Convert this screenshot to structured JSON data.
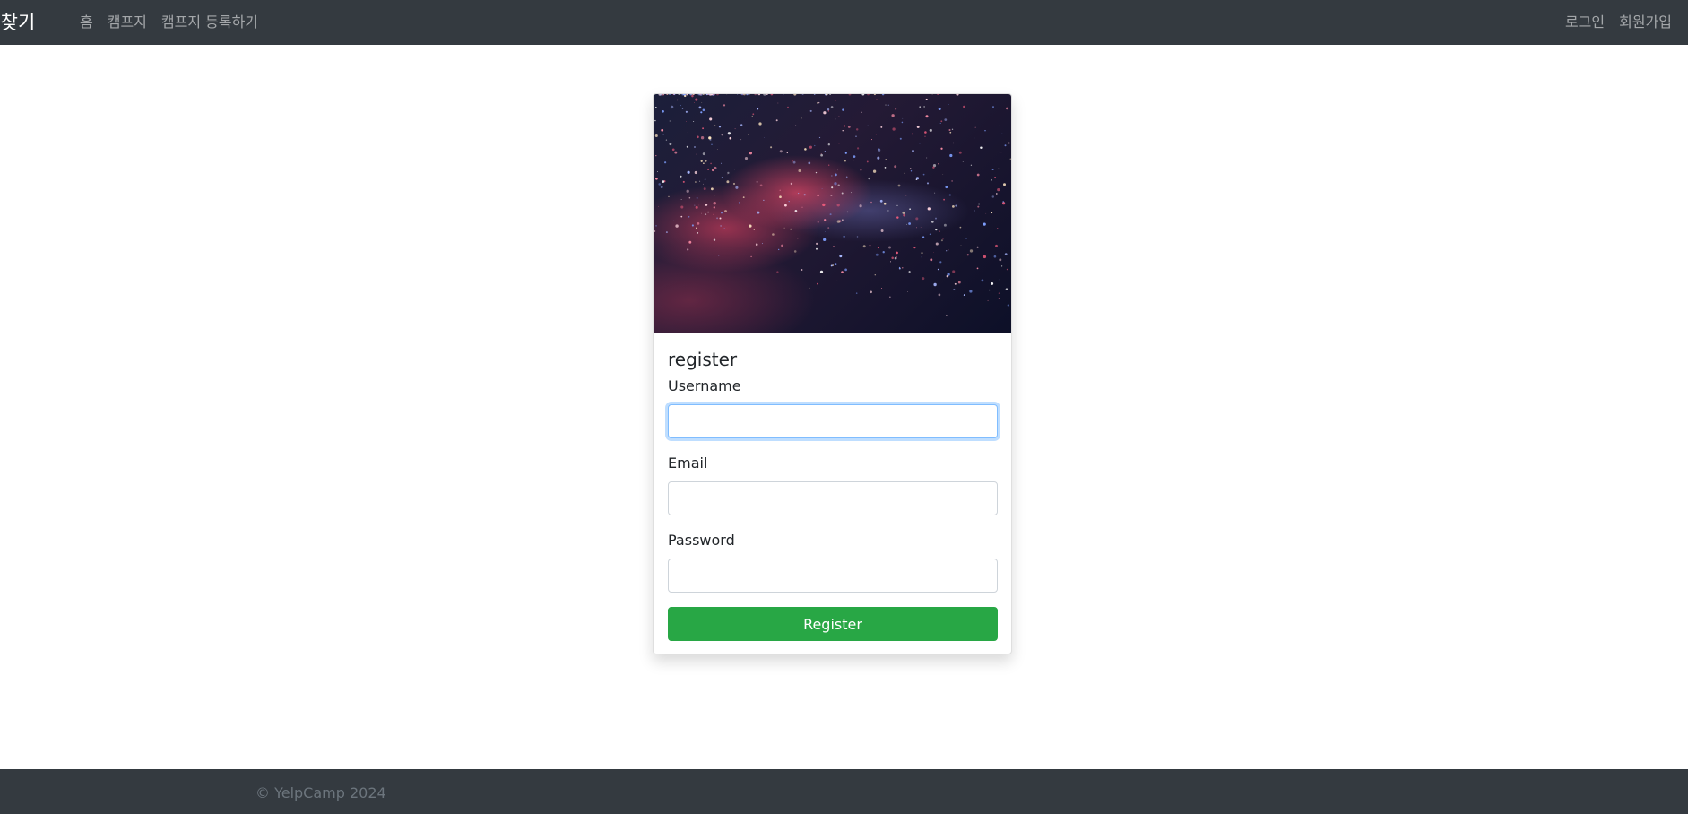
{
  "navbar": {
    "brand": "캠프찾기",
    "left_links": [
      {
        "label": "홈"
      },
      {
        "label": "캠프지"
      },
      {
        "label": "캠프지 등록하기"
      }
    ],
    "right_links": [
      {
        "label": "로그인"
      },
      {
        "label": "회원가입"
      }
    ]
  },
  "card": {
    "image": "starfield-image",
    "title": "register",
    "fields": {
      "username": {
        "label": "Username",
        "value": "",
        "placeholder": ""
      },
      "email": {
        "label": "Email",
        "value": "",
        "placeholder": ""
      },
      "password": {
        "label": "Password",
        "value": "",
        "placeholder": ""
      }
    },
    "submit_label": "Register"
  },
  "footer": {
    "text": "© YelpCamp 2024"
  },
  "colors": {
    "navbar_bg": "#343a40",
    "button_success": "#28a745",
    "focus_border": "#80bdff"
  }
}
